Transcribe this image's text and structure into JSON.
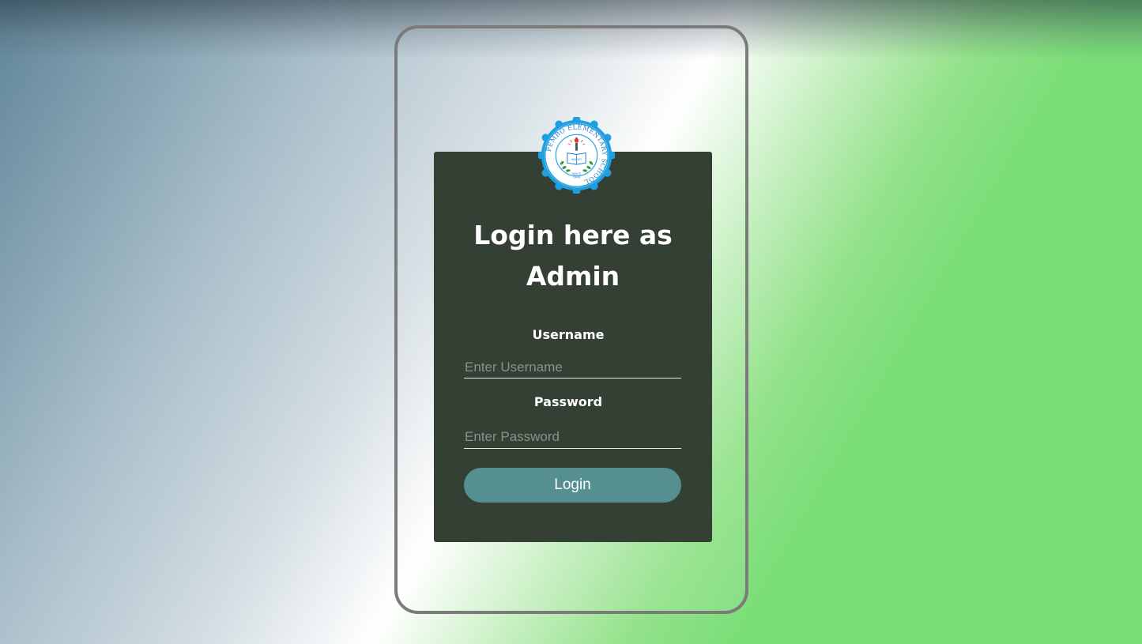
{
  "login_card": {
    "title": "Login here as Admin",
    "username_label": "Username",
    "username_placeholder": "Enter Username",
    "username_value": "",
    "password_label": "Password",
    "password_placeholder": "Enter Password",
    "password_value": "",
    "login_button_label": "Login"
  },
  "logo": {
    "icon": "school-seal-icon",
    "ring_text": "PEMBO ELEMENTARY SCHOOL",
    "since_label": "SINCE",
    "year": "1949",
    "book_text": "MAKATI"
  },
  "colors": {
    "card_bg": "#334033",
    "button_bg": "#558f8f",
    "frame_border": "#7b7b7b",
    "logo_blue": "#1f9fe0"
  }
}
